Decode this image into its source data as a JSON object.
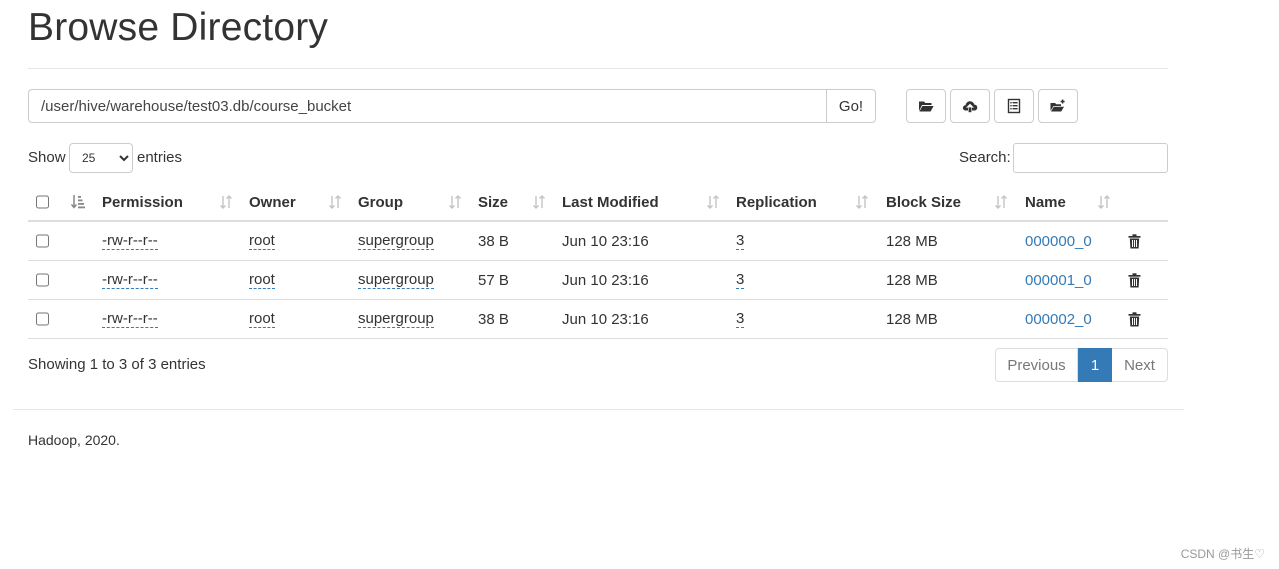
{
  "header": {
    "title": "Browse Directory"
  },
  "path_bar": {
    "value": "/user/hive/warehouse/test03.db/course_bucket",
    "go_label": "Go!"
  },
  "toolbar": {
    "buttons": [
      {
        "icon": "folder-open-icon"
      },
      {
        "icon": "cloud-upload-icon"
      },
      {
        "icon": "list-alt-icon"
      },
      {
        "icon": "folder-plus-icon"
      }
    ]
  },
  "controls": {
    "show_label": "Show",
    "page_size": "25",
    "page_size_options": [
      "25"
    ],
    "entries_label": "entries",
    "search_label": "Search:",
    "search_value": ""
  },
  "table": {
    "columns": [
      "Permission",
      "Owner",
      "Group",
      "Size",
      "Last Modified",
      "Replication",
      "Block Size",
      "Name"
    ],
    "rows": [
      {
        "permission": "-rw-r--r--",
        "owner": "root",
        "group": "supergroup",
        "size": "38 B",
        "modified": "Jun 10 23:16",
        "replication": "3",
        "block_size": "128 MB",
        "name": "000000_0"
      },
      {
        "permission": "-rw-r--r--",
        "owner": "root",
        "group": "supergroup",
        "size": "57 B",
        "modified": "Jun 10 23:16",
        "replication": "3",
        "block_size": "128 MB",
        "name": "000001_0"
      },
      {
        "permission": "-rw-r--r--",
        "owner": "root",
        "group": "supergroup",
        "size": "38 B",
        "modified": "Jun 10 23:16",
        "replication": "3",
        "block_size": "128 MB",
        "name": "000002_0"
      }
    ]
  },
  "pagination": {
    "info": "Showing 1 to 3 of 3 entries",
    "previous": "Previous",
    "current": "1",
    "next": "Next"
  },
  "footer": {
    "text": "Hadoop, 2020."
  },
  "watermark": "CSDN @书生♡",
  "colors": {
    "link": "#337ab7",
    "active_page": "#337ab7",
    "border": "#dddddd"
  }
}
